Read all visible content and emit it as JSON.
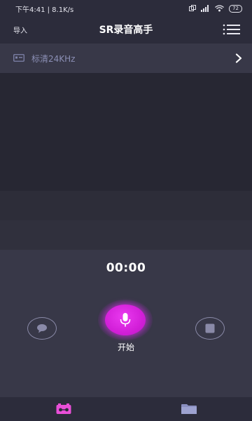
{
  "status_bar": {
    "time_speed": "下午4:41 | 8.1K/s",
    "battery": "72"
  },
  "header": {
    "import_label": "导入",
    "title": "SR录音高手"
  },
  "quality": {
    "label": "标清24KHz"
  },
  "recorder": {
    "timer": "00:00",
    "record_label": "开始"
  },
  "colors": {
    "background": "#2c2c3b",
    "panel": "#383848",
    "accent": "#d21fd8",
    "muted_text": "#8b8fb5",
    "nav_active": "#e94fd8",
    "nav_inactive": "#8a8fc0"
  },
  "icons": {
    "menu": "menu-list-icon",
    "quality": "device-icon",
    "chevron": "chevron-right-icon",
    "left_button": "speech-bubble-icon",
    "center_button": "microphone-icon",
    "right_button": "stop-square-icon",
    "nav_recorder": "cassette-icon",
    "nav_files": "folder-icon"
  }
}
